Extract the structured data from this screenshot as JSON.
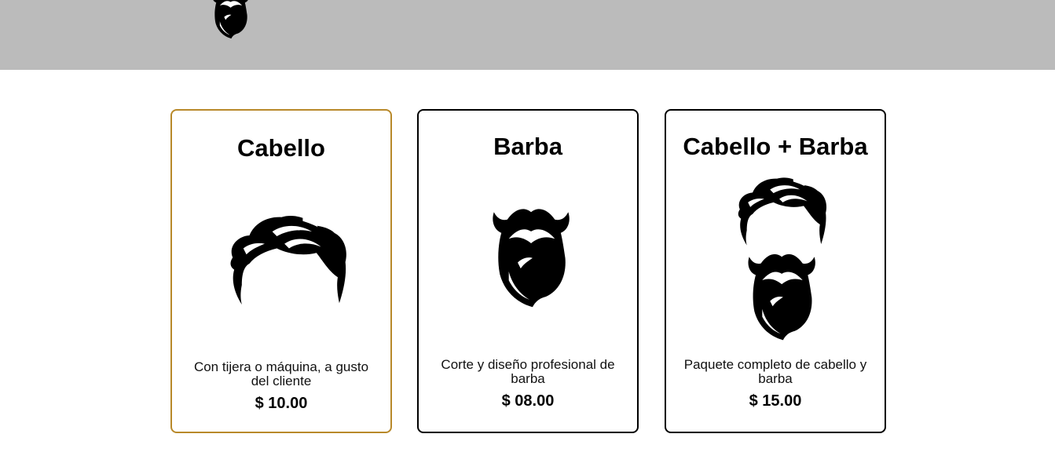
{
  "header": {
    "logo_icon": "beard-icon",
    "background_color": "#bbbbbb"
  },
  "services": [
    {
      "title": "Cabello",
      "icon": "hair-icon",
      "description": "Con tijera o máquina, a gusto del cliente",
      "price": "$ 10.00",
      "selected": true,
      "border_color": "#b8892a"
    },
    {
      "title": "Barba",
      "icon": "beard-icon",
      "description": "Corte y diseño profesional de barba",
      "price": "$ 08.00",
      "selected": false,
      "border_color": "#000000"
    },
    {
      "title": "Cabello + Barba",
      "icon": "hair-and-beard-icon",
      "description": "Paquete completo de cabello y barba",
      "price": "$ 15.00",
      "selected": false,
      "border_color": "#000000"
    }
  ]
}
